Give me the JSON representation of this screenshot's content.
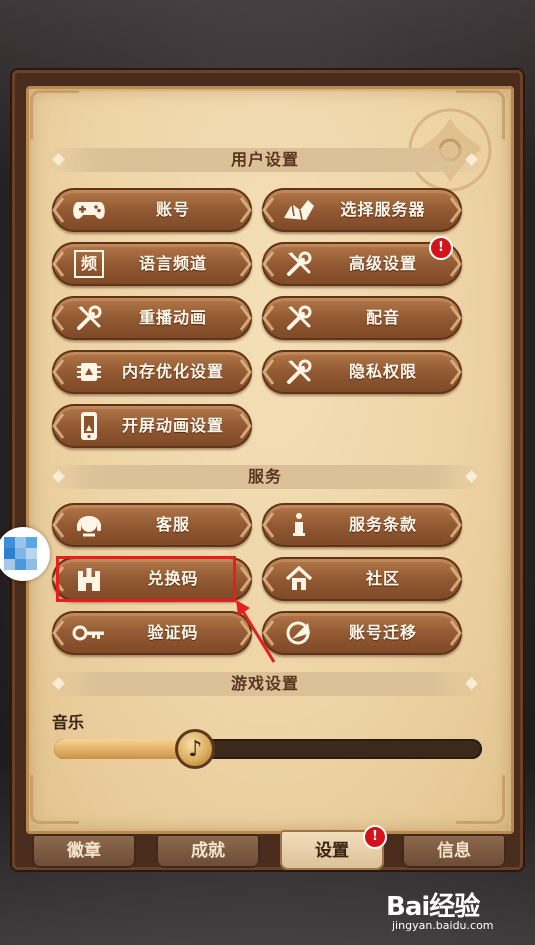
{
  "sections": {
    "user_settings": "用户设置",
    "service": "服务",
    "game_settings": "游戏设置"
  },
  "buttons": {
    "account": "账号",
    "select_server": "选择服务器",
    "language_channel": "语言频道",
    "advanced_settings": "高级设置",
    "replay_animation": "重播动画",
    "dubbing": "配音",
    "memory_optimization": "内存优化设置",
    "privacy_permissions": "隐私权限",
    "splash_animation": "开屏动画设置",
    "customer_service": "客服",
    "terms_of_service": "服务条款",
    "redeem_code": "兑换码",
    "community": "社区",
    "verification_code": "验证码",
    "account_migration": "账号迁移"
  },
  "icons": {
    "language_channel_glyph": "频"
  },
  "badges": {
    "advanced_settings": "!",
    "settings_tab": "!"
  },
  "music": {
    "label": "音乐",
    "volume_fraction": 0.33
  },
  "tabs": [
    {
      "label": "徽章"
    },
    {
      "label": "成就"
    },
    {
      "label": "设置",
      "active": true
    },
    {
      "label": "信息"
    }
  ],
  "watermark": {
    "brand": "Bai经验",
    "site": "jingyan.baidu.com"
  },
  "colors": {
    "panel": "#eed4a6",
    "button": "#935a33",
    "highlight": "#e81d1d",
    "badge": "#d4121b"
  }
}
